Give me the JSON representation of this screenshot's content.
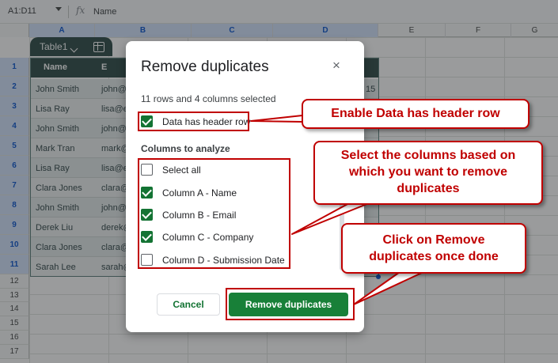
{
  "formula_bar": {
    "namebox": "A1:D11",
    "fx": "fx",
    "content": "Name"
  },
  "grid": {
    "columns": [
      "A",
      "B",
      "C",
      "D",
      "E",
      "F",
      "G"
    ],
    "rows": [
      "1",
      "2",
      "3",
      "4",
      "5",
      "6",
      "7",
      "8",
      "9",
      "10",
      "11",
      "12",
      "13",
      "14",
      "15",
      "16",
      "17"
    ]
  },
  "table": {
    "name": "Table1",
    "headers": [
      "Name",
      "E"
    ],
    "names": [
      "John Smith",
      "Lisa Ray",
      "John Smith",
      "Mark Tran",
      "Lisa Ray",
      "Clara Jones",
      "John Smith",
      "Derek Liu",
      "Clara Jones",
      "Sarah Lee"
    ],
    "emails_partial": [
      "john@",
      "lisa@e",
      "john@",
      "mark@",
      "lisa@e",
      "clara@",
      "john@",
      "derek@",
      "clara@",
      "sarah@"
    ],
    "d_col_partial": [
      "15"
    ]
  },
  "dialog": {
    "title": "Remove duplicates",
    "close": "×",
    "selection_info": "11 rows and 4 columns selected",
    "header_row_label": "Data has header row",
    "header_row_checked": true,
    "columns_title": "Columns to analyze",
    "options": [
      {
        "label": "Select all",
        "checked": false
      },
      {
        "label": "Column A - Name",
        "checked": true
      },
      {
        "label": "Column B - Email",
        "checked": true
      },
      {
        "label": "Column C - Company",
        "checked": true
      },
      {
        "label": "Column D - Submission Date",
        "checked": false
      }
    ],
    "cancel": "Cancel",
    "remove": "Remove duplicates"
  },
  "callouts": {
    "header_row": "Enable Data has header row",
    "columns": "Select the columns based on which you want to remove duplicates",
    "remove": "Click on Remove duplicates once done"
  },
  "colors": {
    "table_header": "#2e4c48",
    "checkbox_green": "#137333",
    "primary_button": "#188038",
    "annotation_red": "#c00000"
  }
}
